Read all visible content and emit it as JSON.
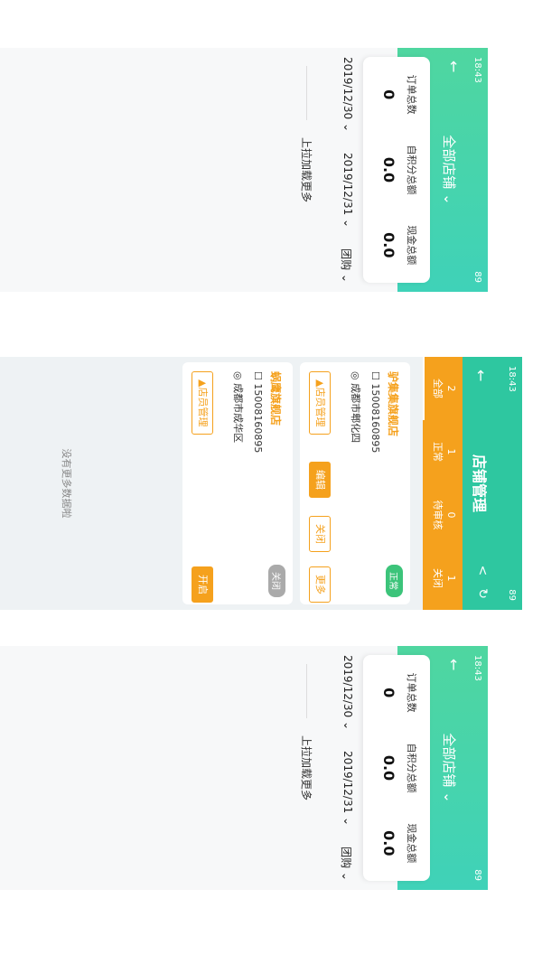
{
  "dashboard": {
    "status_time": "18:43",
    "status_right": "89",
    "title": "全部店铺",
    "stats": [
      {
        "label": "订单总数",
        "value": "0"
      },
      {
        "label": "自积分总额",
        "value": "0.0"
      },
      {
        "label": "现金总额",
        "value": "0.0"
      }
    ],
    "filters": {
      "start": "2019/12/30",
      "end": "2019/12/31",
      "type": "团购"
    },
    "load_more": "上拉加载更多"
  },
  "store": {
    "status_time": "18:43",
    "status_right": "89",
    "title": "店铺管理",
    "tabs": [
      {
        "count": "2",
        "label": "全部"
      },
      {
        "count": "1",
        "label": "正常"
      },
      {
        "count": "0",
        "label": "待审核"
      },
      {
        "count": "1",
        "label": "关闭"
      }
    ],
    "cards": [
      {
        "name": "驴集集旗舰店",
        "status": "正常",
        "status_color": "#3cc47a",
        "phone": "15008160895",
        "address": "成都市郫化四",
        "buttons": [
          "店员管理",
          "编辑",
          "关闭",
          "更多"
        ]
      },
      {
        "name": "蜗鹰旗舰店",
        "status": "关闭",
        "status_color": "#aaaaaa",
        "phone": "15008160895",
        "address": "成都市成华区",
        "buttons": [
          "店员管理",
          "开启"
        ]
      }
    ],
    "no_more": "没有更多数据啦"
  }
}
